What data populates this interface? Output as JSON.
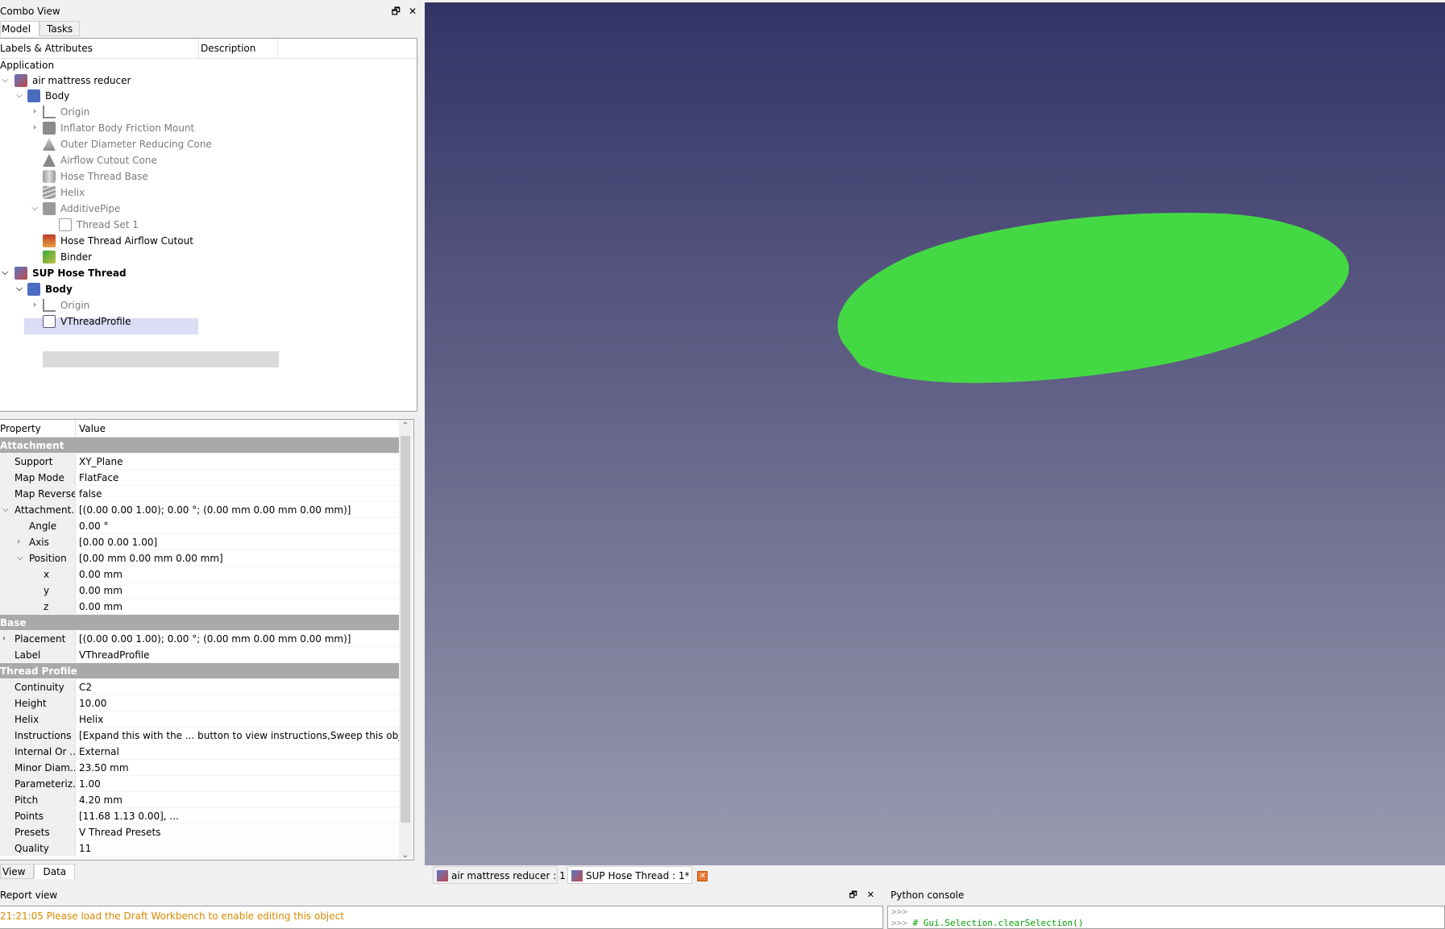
{
  "combo_view": {
    "title": "Combo View",
    "float_icon": "restore-icon",
    "close_icon": "close-icon",
    "tabs": [
      "Model",
      "Tasks"
    ],
    "active_tab": "Model"
  },
  "tree": {
    "headers": [
      "Labels & Attributes",
      "Description"
    ],
    "root": "Application",
    "items": [
      {
        "label": "air mattress reducer",
        "chev": "v",
        "icon": "document-icon"
      },
      {
        "label": "Body",
        "chev": "v",
        "icon": "body-icon"
      },
      {
        "label": "Origin",
        "chev": ">",
        "icon": "origin-icon"
      },
      {
        "label": "Inflator Body Friction Mount",
        "chev": ">",
        "icon": "pad-icon"
      },
      {
        "label": "Outer Diameter Reducing Cone",
        "chev": "",
        "icon": "cone-icon"
      },
      {
        "label": "Airflow Cutout Cone",
        "chev": "",
        "icon": "cone-icon"
      },
      {
        "label": "Hose Thread Base",
        "chev": "",
        "icon": "cylinder-icon"
      },
      {
        "label": "Helix",
        "chev": "",
        "icon": "helix-icon"
      },
      {
        "label": "AdditivePipe",
        "chev": "v",
        "icon": "pipe-icon"
      },
      {
        "label": "Thread Set 1",
        "chev": "",
        "icon": "sketch-icon"
      },
      {
        "label": "Hose Thread Airflow Cutout",
        "chev": "",
        "icon": "subtractive-icon"
      },
      {
        "label": "Binder",
        "chev": "",
        "icon": "binder-icon"
      },
      {
        "label": "SUP Hose Thread",
        "chev": "v",
        "icon": "document-icon"
      },
      {
        "label": "Body",
        "chev": "v",
        "icon": "body-icon"
      },
      {
        "label": "Origin",
        "chev": ">",
        "icon": "origin-icon"
      },
      {
        "label": "VThreadProfile",
        "chev": "",
        "icon": "sketch-icon"
      }
    ]
  },
  "properties": {
    "headers": [
      "Property",
      "Value"
    ],
    "rows": [
      {
        "type": "group",
        "name": "Attachment"
      },
      {
        "name": "Support",
        "value": "XY_Plane"
      },
      {
        "name": "Map Mode",
        "value": "FlatFace"
      },
      {
        "name": "Map Reversed",
        "value": "false"
      },
      {
        "name": "Attachment...",
        "value": "[(0.00 0.00 1.00); 0.00 °; (0.00 mm  0.00 mm  0.00 mm)]",
        "exp": "v"
      },
      {
        "name": "Angle",
        "value": "0.00 °",
        "indent": 1
      },
      {
        "name": "Axis",
        "value": "[0.00 0.00 1.00]",
        "indent": 1,
        "exp": ">"
      },
      {
        "name": "Position",
        "value": "[0.00 mm  0.00 mm  0.00 mm]",
        "indent": 1,
        "exp": "v"
      },
      {
        "name": "x",
        "value": "0.00 mm",
        "indent": 2
      },
      {
        "name": "y",
        "value": "0.00 mm",
        "indent": 2
      },
      {
        "name": "z",
        "value": "0.00 mm",
        "indent": 2
      },
      {
        "type": "group",
        "name": "Base"
      },
      {
        "name": "Placement",
        "value": "[(0.00 0.00 1.00); 0.00 °; (0.00 mm  0.00 mm  0.00 mm)]",
        "exp": ">"
      },
      {
        "name": "Label",
        "value": "VThreadProfile"
      },
      {
        "type": "group",
        "name": "Thread Profile"
      },
      {
        "name": "Continuity",
        "value": "C2"
      },
      {
        "name": "Height",
        "value": "10.00"
      },
      {
        "name": "Helix",
        "value": "Helix"
      },
      {
        "name": "Instructions",
        "value": "[Expand this with the ... button to view instructions,Sweep this object alo..."
      },
      {
        "name": "Internal Or ...",
        "value": "External"
      },
      {
        "name": "Minor Diam...",
        "value": "23.50 mm"
      },
      {
        "name": "Parameteriz...",
        "value": "1.00"
      },
      {
        "name": "Pitch",
        "value": "4.20 mm"
      },
      {
        "name": "Points",
        "value": "[11.68 1.13 0.00], ..."
      },
      {
        "name": "Presets",
        "value": "V Thread Presets"
      },
      {
        "name": "Quality",
        "value": "11"
      }
    ],
    "bottom_tabs": [
      "View",
      "Data"
    ],
    "active_bottom_tab": "Data"
  },
  "view_tabs": [
    {
      "label": "air mattress reducer : 1",
      "active": false
    },
    {
      "label": "SUP Hose Thread : 1*",
      "active": true
    }
  ],
  "report_view": {
    "title": "Report view",
    "message": "21:21:05  Please load the Draft Workbench to enable editing this object"
  },
  "python_console": {
    "title": "Python console",
    "line1_prompt": ">>>",
    "line2_prompt": ">>>",
    "line2_cmd": "# Gui.Selection.clearSelection()"
  },
  "colors": {
    "viewport_top": "#333366",
    "viewport_bottom": "#9a9ab0",
    "shape_fill": "#44d944",
    "group_row": "#a9a9a9",
    "warning_text": "#d98a00"
  }
}
